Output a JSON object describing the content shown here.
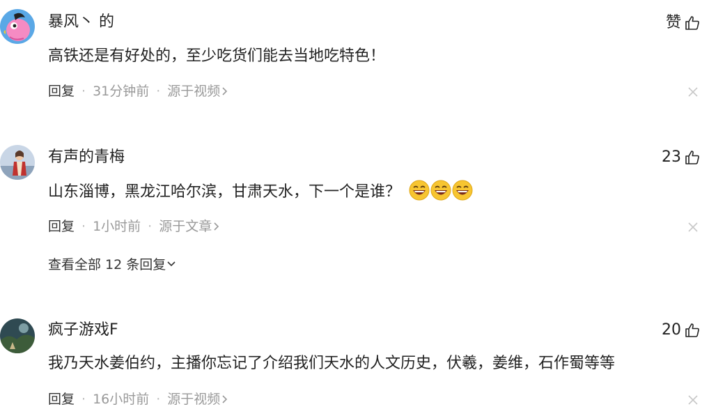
{
  "comments": [
    {
      "username": "暴风丶 的",
      "like_count": "赞",
      "content": "高铁还是有好处的，至少吃货们能去当地吃特色！",
      "reply_label": "回复",
      "time": "31分钟前",
      "source": "源于视频",
      "avatar_icon": "pink-bird-avatar",
      "avatar_color": "#5aa8e6"
    },
    {
      "username": "有声的青梅",
      "like_count": "23",
      "content": "山东淄博，黑龙江哈尔滨，甘肃天水，下一个是谁？",
      "reply_label": "回复",
      "time": "1小时前",
      "source": "源于文章",
      "avatar_icon": "costume-person-avatar",
      "view_all_label": "查看全部 12 条回复",
      "emoji": [
        "grinning-emoji",
        "grinning-emoji",
        "grinning-emoji"
      ]
    },
    {
      "username": "疯子游戏F",
      "like_count": "20",
      "content": "我乃天水姜伯约，主播你忘记了介绍我们天水的人文历史，伏羲，姜维，石作蜀等等",
      "reply_label": "回复",
      "time": "16小时前",
      "source": "源于视频",
      "avatar_icon": "game-scene-avatar"
    }
  ],
  "colors": {
    "text": "#222222",
    "muted": "#999999",
    "emoji_face": "#f7c531"
  }
}
